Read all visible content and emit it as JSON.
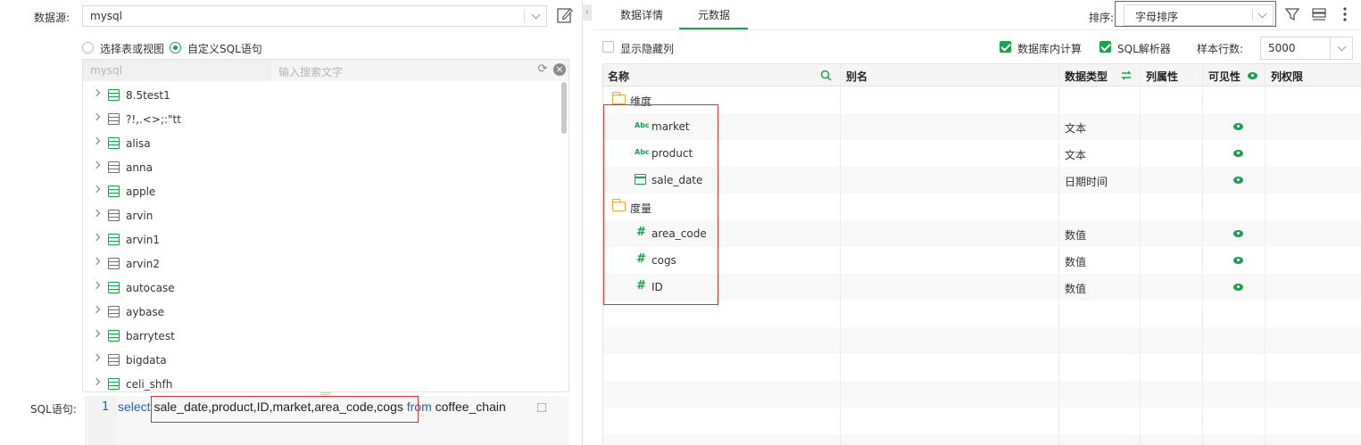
{
  "datasource": {
    "label": "数据源:",
    "value": "mysql"
  },
  "mode": {
    "option_table": "选择表或视图",
    "option_sql": "自定义SQL语句",
    "selected": "自定义SQL语句"
  },
  "tree": {
    "db_label": "mysql",
    "search_placeholder": "输入搜索文字",
    "items": [
      "8.5test1",
      "?!,.<>;:\"tt",
      "alisa",
      "anna",
      "apple",
      "arvin",
      "arvin1",
      "arvin2",
      "autocase",
      "aybase",
      "barrytest",
      "bigdata",
      "celi_shfh"
    ]
  },
  "sql": {
    "label": "SQL语句:",
    "line_number": "1",
    "keyword_select": "select",
    "columns": "sale_date,product,ID,market,area_code,cogs",
    "keyword_from": "from",
    "table": "coffee_chain"
  },
  "tabs": {
    "details": "数据详情",
    "metadata": "元数据",
    "active": "元数据"
  },
  "sort": {
    "label": "排序:",
    "value": "字母排序"
  },
  "options": {
    "show_hidden": {
      "label": "显示隐藏列",
      "checked": false
    },
    "db_compute": {
      "label": "数据库内计算",
      "checked": true
    },
    "sql_parser": {
      "label": "SQL解析器",
      "checked": true
    },
    "sample_rows_label": "样本行数:",
    "sample_rows_value": "5000"
  },
  "grid": {
    "headers": {
      "name": "名称",
      "alias": "别名",
      "type": "数据类型",
      "attr": "列属性",
      "visible": "可见性",
      "perm": "列权限"
    },
    "groups": [
      {
        "name": "维度",
        "fields": [
          {
            "name": "market",
            "icon": "abc-icon",
            "type": "文本",
            "visible": true
          },
          {
            "name": "product",
            "icon": "abc-icon",
            "type": "文本",
            "visible": true
          },
          {
            "name": "sale_date",
            "icon": "calendar-icon",
            "type": "日期时间",
            "visible": true
          }
        ]
      },
      {
        "name": "度量",
        "fields": [
          {
            "name": "area_code",
            "icon": "hash-icon",
            "type": "数值",
            "visible": true
          },
          {
            "name": "cogs",
            "icon": "hash-icon",
            "type": "数值",
            "visible": true
          },
          {
            "name": "ID",
            "icon": "hash-icon",
            "type": "数值",
            "visible": true
          }
        ]
      }
    ]
  },
  "colors": {
    "accent": "#17a34a",
    "highlight": "#e03232",
    "folder": "#f3a43b",
    "sql_keyword": "#2461b7"
  }
}
